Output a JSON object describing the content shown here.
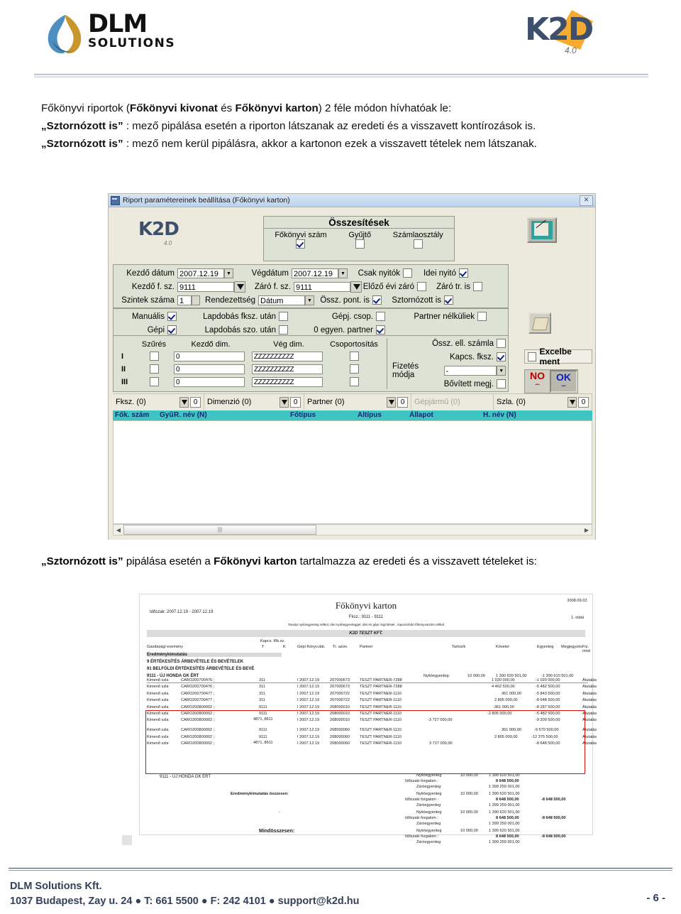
{
  "header": {
    "dlm_logo": {
      "word": "DLM",
      "sub": "SOLUTIONS",
      "icon": "dlm-leaf-logo"
    },
    "k2d_logo": {
      "word": "K2D",
      "version": "4.0"
    }
  },
  "intro": {
    "line1_a": "Főkönyvi riportok (",
    "line1_b": "Főkönyvi kivonat",
    "line1_c": " és ",
    "line1_d": "Főkönyvi karton",
    "line1_e": ") 2 féle módon hívhatóak le:",
    "para2_bold": "„Sztornózott is”",
    "para2_rest": " : mező pipálása esetén a riporton látszanak az eredeti és a visszavett kontírozások is.",
    "para3_bold": "„Sztornózott is”",
    "para3_rest": " : mező nem kerül pipálásra, akkor a kartonon ezek a visszavett tételek nem látszanak."
  },
  "dialog": {
    "title": "Riport paramétereinek beállítása  (Főkönyvi karton)",
    "close_label": "✕",
    "logo": {
      "word": "K2D",
      "version": "4.0"
    },
    "summary_group": {
      "title": "Összesítések",
      "items": [
        {
          "label": "Főkönyvi szám",
          "checked": true
        },
        {
          "label": "Gyűjtő",
          "checked": false
        },
        {
          "label": "Számlaosztály",
          "checked": false
        }
      ]
    },
    "params": {
      "kezdo_datum_label": "Kezdő dátum",
      "kezdo_datum_value": "2007.12.19",
      "vegdatum_label": "Végdátum",
      "vegdatum_value": "2007.12.19",
      "csak_nyitok_label": "Csak nyitók",
      "csak_nyitok_checked": false,
      "idei_nyito_label": "Idei nyitó",
      "idei_nyito_checked": true,
      "kezdo_fsz_label": "Kezdő f. sz.",
      "kezdo_fsz_value": "9111",
      "zaro_fsz_label": "Záró f. sz.",
      "zaro_fsz_value": "9111",
      "elozo_evi_zaro_label": "Előző évi záró",
      "elozo_evi_zaro_checked": false,
      "zaro_tr_label": "Záró tr. is",
      "zaro_tr_checked": false,
      "szintek_label": "Szintek száma",
      "szintek_value": "1",
      "rendezettseg_label": "Rendezettség",
      "rendezettseg_value": "Dátum",
      "ossz_pont_label": "Össz. pont. is",
      "ossz_pont_checked": true,
      "sztornozott_label": "Sztornózott is",
      "sztornozott_checked": true
    },
    "options": {
      "manualis_label": "Manuális",
      "manualis_checked": true,
      "gepi_label": "Gépi",
      "gepi_checked": true,
      "lapdobas_fksz_label": "Lapdobás fksz. után",
      "lapdobas_fksz_checked": false,
      "lapdobas_szo_label": "Lapdobás szo. után",
      "lapdobas_szo_checked": false,
      "gepj_csop_label": "Gépj. csop.",
      "gepj_csop_checked": false,
      "nulla_egyen_label": "0 egyen. partner",
      "nulla_egyen_checked": true,
      "partner_nelkuliek_label": "Partner nélküliek",
      "partner_nelkuliek_checked": false
    },
    "filter_table": {
      "headers": [
        "Szűrés",
        "Kezdő dim.",
        "Vég dim.",
        "Csoportosítás"
      ],
      "rows": [
        {
          "label": "I",
          "szures": false,
          "kezdo": "0",
          "veg": "ZZZZZZZZZZ",
          "csoport": false
        },
        {
          "label": "II",
          "szures": false,
          "kezdo": "0",
          "veg": "ZZZZZZZZZZ",
          "csoport": false
        },
        {
          "label": "III",
          "szures": false,
          "kezdo": "0",
          "veg": "ZZZZZZZZZZ",
          "csoport": false
        }
      ]
    },
    "right_options": {
      "ossz_ell_szamla_label": "Össz. ell. számla",
      "ossz_ell_szamla_checked": false,
      "kapcs_fksz_label": "Kapcs. fksz.",
      "kapcs_fksz_checked": true,
      "fizetes_modja_label": "Fizetés módja",
      "fizetes_modja_value": "-",
      "bovitett_megj_label": "Bővített megj.",
      "bovitett_megj_checked": false
    },
    "buttons": {
      "excel_label": "Excelbe ment",
      "excel_checked": false,
      "no_label": "NO",
      "ok_label": "OK",
      "edit_icon": "report-preview-icon",
      "print_icon": "print-icon"
    },
    "counters": [
      {
        "label": "Fksz. (0)",
        "value": "0",
        "disabled": false
      },
      {
        "label": "Dimenzió (0)",
        "value": "0",
        "disabled": false
      },
      {
        "label": "Partner (0)",
        "value": "0",
        "disabled": false
      },
      {
        "label": "Gépjármű (0)",
        "value": "",
        "disabled": true
      },
      {
        "label": "Szla. (0)",
        "value": "0",
        "disabled": false
      }
    ],
    "grid_headers": [
      "Fők. szám",
      "Gyű",
      "R. név (N)",
      "Főtípus",
      "Altípus",
      "Állapot",
      "H. név (N)"
    ],
    "scroll_hint": "|||"
  },
  "caption": {
    "bold1": "„Sztornózott is”",
    "mid": " pipálása esetén a ",
    "bold2": "Főkönyvi karton",
    "rest": " tartalmazza az eredeti és a visszavett tételeket is:"
  },
  "report": {
    "title": "Főkönyvi karton",
    "date": "2008.09.02.",
    "page": "1. oldal",
    "period": "Időszak: 2007.12.19 - 2007.12.19",
    "fksz": "Fksz.: 9111 - 9111",
    "note": "Tavalyi nyitóegyenleg nélkül, idei nyitóegyenleggel, idei és gépi rögzítések , kapcsolódó főkönyviszám nélkül",
    "company": "K2D TESZT KFT.",
    "col_headers": {
      "gazdasagi": "Gazdasági esemény",
      "kapcs": "Kapcs. fők.sz.",
      "t": "T",
      "k": "K",
      "gepi": "Gépi Könyv.dát.",
      "tr": "Tr. azon.",
      "partner": "Partner",
      "tartozik": "Tartozik",
      "kovetel": "Követel",
      "egyenleg": "Egyenleg",
      "megjegyzes": "Megjegyzés",
      "fiz": "Fiz. mód"
    },
    "groups": [
      "Eredménykimutatás",
      "9     ÉRTÉKESÍTÉS ÁRBEVÉTELE ÉS BEVÉTELEK",
      "91    BELFÖLDI ÉRTÉKESÍTÉS ÁRBEVÉTELE ÉS BEVÉ",
      "9111 - ÚJ HONDA GK ÉRT"
    ],
    "opening": {
      "label": "Nyitóegyenleg:",
      "tartozik": "10 000,00",
      "kovetel": "1 390 620 501,00",
      "egyenleg": "-1 390 610 501,00"
    },
    "rows": [
      {
        "gazd": "Kimenő szla",
        "biz": "CARO200700476 ;",
        "kapcs": "311",
        "gepi": "I 2007.12.19",
        "tr": "207000673",
        "partner": "TESZT PARTNER-7288",
        "tartozik": "",
        "kovetel": "1 020 000,00",
        "egyenleg": "-1 020 000,00",
        "fiz": "Átutalás",
        "flagged": false
      },
      {
        "gazd": "Kimenő szla",
        "biz": "CARO200700476 ;",
        "kapcs": "311",
        "gepi": "I 2007.12.19",
        "tr": "207000673",
        "partner": "TESZT PARTNER-7288",
        "tartozik": "",
        "kovetel": "4 462 500,00",
        "egyenleg": "-5 482 500,00",
        "fiz": "Átutalás",
        "flagged": false
      },
      {
        "gazd": "Kimenő szla",
        "biz": "CARO200700477 ;",
        "kapcs": "311",
        "gepi": "I 2007.12.19",
        "tr": "207000722",
        "partner": "TESZT PARTNER-1110",
        "tartozik": "",
        "kovetel": "361 000,00",
        "egyenleg": "-5 843 500,00",
        "fiz": "Átutalás",
        "flagged": false
      },
      {
        "gazd": "Kimenő szla",
        "biz": "CARO200700477 ;",
        "kapcs": "311",
        "gepi": "I 2007.12.19",
        "tr": "207000722",
        "partner": "TESZT PARTNER-1110",
        "tartozik": "",
        "kovetel": "2 805 000,00",
        "egyenleg": "-8 648 500,00",
        "fiz": "Átutalás",
        "flagged": false
      },
      {
        "gazd": "Kimenő szla",
        "biz": "CARO200800002 ;",
        "kapcs": "9111",
        "gepi": "I 2007.12.19",
        "tr": "208000010",
        "partner": "TESZT PARTNER-1110",
        "tartozik": "",
        "kovetel": "-361 000,00",
        "egyenleg": "-8 287 500,00",
        "fiz": "Átutalás",
        "flagged": true
      },
      {
        "gazd": "Kimenő szla",
        "biz": "CARO200800002 ;",
        "kapcs": "9111",
        "gepi": "I 2007.12.19",
        "tr": "208000010",
        "partner": "TESZT PARTNER-1110",
        "tartozik": "",
        "kovetel": "-2 805 000,00",
        "egyenleg": "-5 482 500,00",
        "fiz": "Átutalás",
        "flagged": true
      },
      {
        "gazd": "Kimenő szla",
        "biz": "CARO200800002 ;",
        "kapcs": "4871, 8611",
        "gepi": "I 2007.12.19",
        "tr": "208000010",
        "partner": "TESZT PARTNER-1110",
        "tartozik": "-3 727 000,00",
        "kovetel": "",
        "egyenleg": "-9 209 500,00",
        "fiz": "Átutalás",
        "flagged": true
      },
      {
        "gazd": "Kimenő szla",
        "biz": "CARO200800002 ;",
        "kapcs": "9111",
        "gepi": "I 2007.12.19",
        "tr": "208000060",
        "partner": "TESZT PARTNER-1110",
        "tartozik": "",
        "kovetel": "361 000,00",
        "egyenleg": "-9 570 500,00",
        "fiz": "Átutalás",
        "flagged": true
      },
      {
        "gazd": "Kimenő szla",
        "biz": "CARO200800002 ;",
        "kapcs": "9111",
        "gepi": "I 2007.12.19",
        "tr": "208000060",
        "partner": "TESZT PARTNER-1110",
        "tartozik": "",
        "kovetel": "2 805 000,00",
        "egyenleg": "-12 375 500,00",
        "fiz": "Átutalás",
        "flagged": true
      },
      {
        "gazd": "Kimenő szla",
        "biz": "CARO200800002 ;",
        "kapcs": "4871, 8611",
        "gepi": "I 2007.12.19",
        "tr": "208000060",
        "partner": "TESZT PARTNER-1110",
        "tartozik": "3 727 000,00",
        "kovetel": "",
        "egyenleg": "-8 648 500,00",
        "fiz": "Átutalás",
        "flagged": true
      }
    ],
    "account_footer_label": "9111 - ÚJ HONDA GK ÉRT",
    "totals": [
      {
        "label": "",
        "nyito_label": "Nyitóegyenleg",
        "nyito_t": "10 000,00",
        "nyito_k": "1 390 620 501,00",
        "forg_label": "Időszaki forgalom :",
        "forg_k": "8 648 500,00",
        "zaro_label": "Záróegyenleg",
        "zaro_k": "1 399 259 001,00",
        "right": ""
      },
      {
        "label": "Eredménykimutatás összesen:",
        "nyito_label": "Nyitóegyenleg",
        "nyito_t": "10 000,00",
        "nyito_k": "1 390 620 501,00",
        "forg_label": "Időszaki forgalom :",
        "forg_k": "8 648 500,00",
        "zaro_label": "Záróegyenleg",
        "zaro_k": "1 399 259 001,00",
        "right": "-8 648 500,00"
      },
      {
        "label": "-",
        "nyito_label": "Nyitóegyenleg",
        "nyito_t": "10 000,00",
        "nyito_k": "1 390 620 501,00",
        "forg_label": "Időszaki forgalom :",
        "forg_k": "8 648 500,00",
        "zaro_label": "Záróegyenleg",
        "zaro_k": "1 399 259 001,00",
        "right": "-8 648 500,00"
      },
      {
        "label": "Mindösszesen:",
        "nyito_label": "Nyitóegyenleg",
        "nyito_t": "10 000,00",
        "nyito_k": "1 390 620 501,00",
        "forg_label": "Időszaki forgalom :",
        "forg_k": "8 648 500,00",
        "zaro_label": "Záróegyenleg",
        "zaro_k": "1 399 259 001,00",
        "right": "-8 648 500,00"
      }
    ]
  },
  "footer": {
    "company": "DLM Solutions Kft.",
    "address": "1037 Budapest, Zay u. 24  ●  T: 661 5500 ● F: 242 4101 ● support@k2d.hu",
    "page": "- 6 -"
  },
  "colors": {
    "accent_red": "#e01010",
    "grid_header": "#3fc4c4",
    "dialog_bg": "#ece9dd",
    "group_bg": "#dde3d4",
    "footer_text": "#34405a"
  }
}
